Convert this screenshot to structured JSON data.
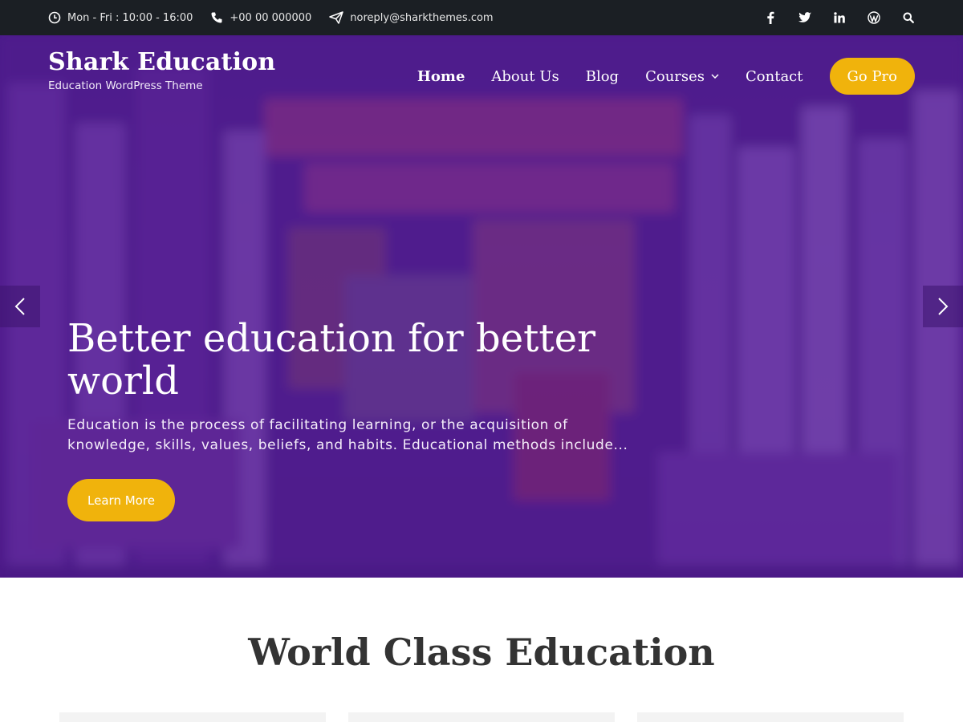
{
  "topbar": {
    "hours": "Mon - Fri : 10:00 - 16:00",
    "phone": "+00 00 000000",
    "email": "noreply@sharkthemes.com",
    "social": [
      {
        "icon": "facebook-icon",
        "glyph": "f"
      },
      {
        "icon": "twitter-icon",
        "glyph": "t"
      },
      {
        "icon": "linkedin-icon",
        "glyph": "in"
      },
      {
        "icon": "wordpress-icon",
        "glyph": "W"
      },
      {
        "icon": "search-icon",
        "glyph": ""
      }
    ]
  },
  "brand": {
    "title": "Shark Education",
    "tagline": "Education WordPress Theme"
  },
  "nav": {
    "items": [
      "Home",
      "About Us",
      "Blog",
      "Courses",
      "Contact"
    ],
    "active": "Home",
    "cta": "Go Pro"
  },
  "slide": {
    "title": "Better education for better world",
    "description": "Education is the process of facilitating learning, or the acquisition of knowledge, skills, values, beliefs, and habits. Educational methods include...",
    "button": "Learn More"
  },
  "section": {
    "title": "World Class Education"
  },
  "colors": {
    "accent": "#f0b30c",
    "topbar": "#1b1f24",
    "hero_overlay": "#5a1e93"
  }
}
